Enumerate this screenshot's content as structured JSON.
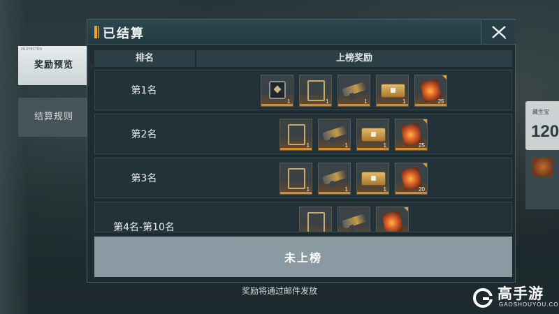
{
  "panel": {
    "title": "已结算"
  },
  "tabs": [
    {
      "label": "奖励预览",
      "active": true,
      "tiny": "PROTECTED"
    },
    {
      "label": "结算规则",
      "active": false
    }
  ],
  "table": {
    "col_rank": "排名",
    "col_reward": "上榜奖励",
    "rows": [
      {
        "rank": "第1名",
        "items": [
          {
            "icon": "badge-icon",
            "qty": "1"
          },
          {
            "icon": "frame-icon",
            "qty": "1"
          },
          {
            "icon": "gun-icon",
            "qty": "1"
          },
          {
            "icon": "crate-icon",
            "qty": "1"
          },
          {
            "icon": "gem-icon",
            "qty": "25"
          }
        ]
      },
      {
        "rank": "第2名",
        "items": [
          {
            "icon": "frame-icon",
            "qty": "1"
          },
          {
            "icon": "gun-icon",
            "qty": "1"
          },
          {
            "icon": "crate-icon",
            "qty": "1"
          },
          {
            "icon": "gem-icon",
            "qty": "25"
          }
        ]
      },
      {
        "rank": "第3名",
        "items": [
          {
            "icon": "frame-icon",
            "qty": "1"
          },
          {
            "icon": "gun-icon",
            "qty": "1"
          },
          {
            "icon": "crate-icon",
            "qty": "1"
          },
          {
            "icon": "gem-icon",
            "qty": "20"
          }
        ]
      },
      {
        "rank": "第4名-第10名",
        "items": [
          {
            "icon": "frame-icon",
            "qty": ""
          },
          {
            "icon": "gun-icon",
            "qty": ""
          },
          {
            "icon": "gem-icon",
            "qty": ""
          }
        ]
      }
    ]
  },
  "not_ranked": "未上榜",
  "footer_note": "奖励将通过邮件发放",
  "background": {
    "right_card_number": "120",
    "right_card_text": "藏生宝"
  },
  "watermark": {
    "brand": "高手游",
    "site": "GAOSHOUYOU.COM"
  },
  "colors": {
    "accent": "#e6a630",
    "panel_bg": "#1e2c32",
    "not_ranked_bg": "#8b9aa2",
    "item_highlight": "#d88a2e"
  }
}
